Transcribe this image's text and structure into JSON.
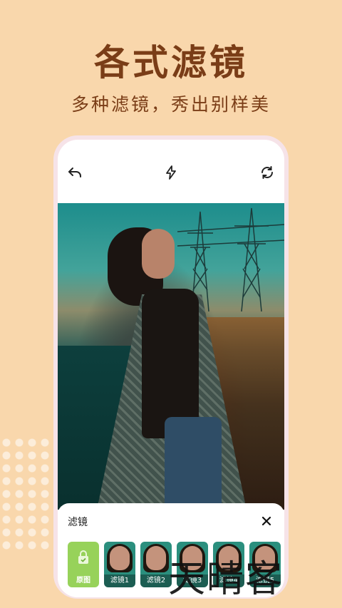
{
  "headline": "各式滤镜",
  "subline": "多种滤镜，秀出别样美",
  "toolbar": {
    "undo_icon": "undo-icon",
    "flash_icon": "flash-icon",
    "switch_icon": "refresh-icon"
  },
  "filter_panel": {
    "title": "滤镜",
    "close_icon": "close-icon",
    "items": [
      {
        "label": "原图",
        "type": "original",
        "icon": "lock-icon"
      },
      {
        "label": "滤镜1",
        "type": "filter"
      },
      {
        "label": "滤镜2",
        "type": "filter"
      },
      {
        "label": "滤镜3",
        "type": "filter"
      },
      {
        "label": "滤镜4",
        "type": "filter"
      },
      {
        "label": "滤镜5",
        "type": "filter"
      }
    ]
  },
  "watermark": "天晴客",
  "colors": {
    "background": "#f9d7ac",
    "headline": "#7a3d17",
    "original_thumb": "#97d25a"
  }
}
